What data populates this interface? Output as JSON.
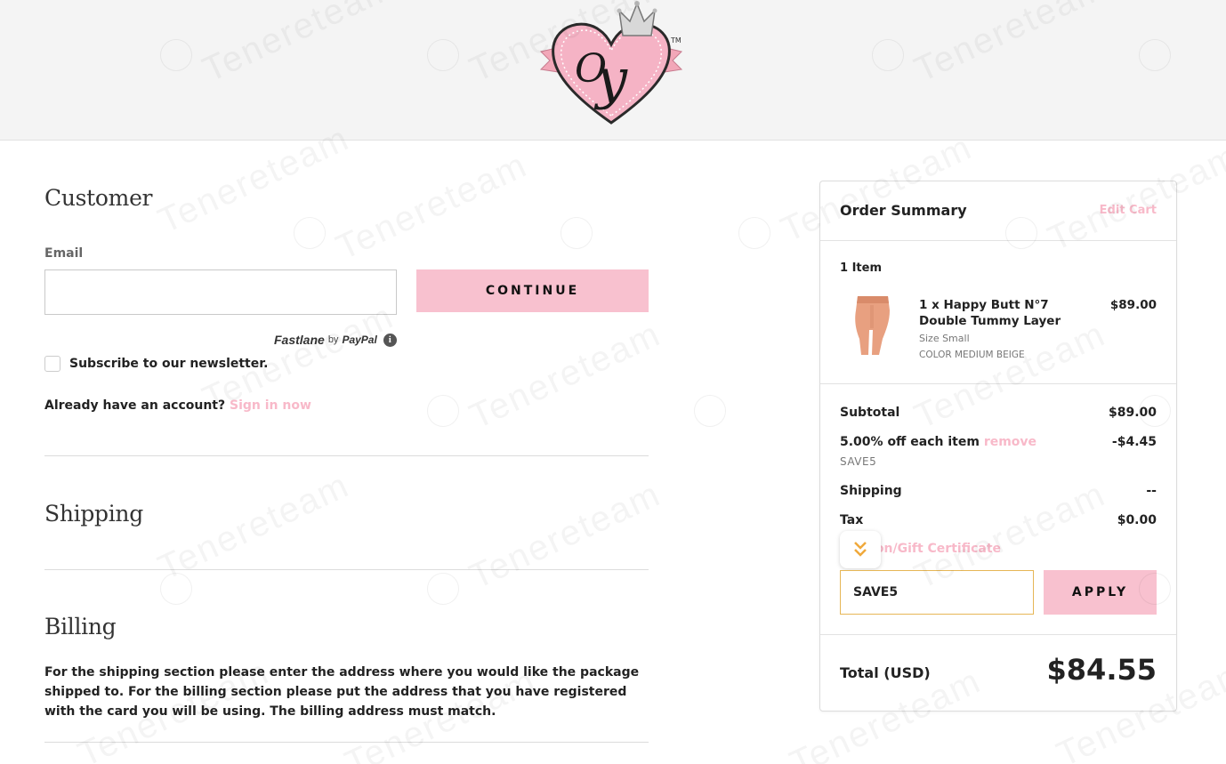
{
  "header": {
    "logo_alt": "Tenere Y logo"
  },
  "customer": {
    "title": "Customer",
    "email_label": "Email",
    "email_value": "",
    "continue_label": "CONTINUE",
    "fastlane": {
      "brand": "Fastlane",
      "by": "by",
      "provider": "PayPal"
    },
    "newsletter_label": "Subscribe to our newsletter.",
    "account_text": "Already have an account?",
    "sign_in_label": "Sign in now"
  },
  "shipping": {
    "title": "Shipping"
  },
  "billing": {
    "title": "Billing",
    "note": "For the shipping section please enter the address where you would like the package shipped to. For the billing section please put the address that you have registered with the card you will be using. The billing address must match."
  },
  "summary": {
    "title": "Order Summary",
    "edit_cart": "Edit Cart",
    "items_count": "1 Item",
    "product": {
      "name": "1 x Happy Butt N°7 Double Tummy Layer",
      "price": "$89.00",
      "size": "Size Small",
      "color": "COLOR MEDIUM BEIGE"
    },
    "subtotal_label": "Subtotal",
    "subtotal_value": "$89.00",
    "discount_label": "5.00% off each item",
    "discount_remove": "remove",
    "discount_value": "-$4.45",
    "discount_code": "SAVE5",
    "shipping_label": "Shipping",
    "shipping_value": "--",
    "tax_label": "Tax",
    "tax_value": "$0.00",
    "coupon_label": "Coupon/Gift Certificate",
    "coupon_value": "SAVE5",
    "apply_label": "APPLY",
    "total_label": "Total (USD)",
    "total_value": "$84.55"
  },
  "watermark": {
    "text": "Tenereteam"
  },
  "colors": {
    "accent_pink": "#f8c1cf",
    "link_pink": "#f8b9c9",
    "coupon_border": "#e6b656"
  }
}
